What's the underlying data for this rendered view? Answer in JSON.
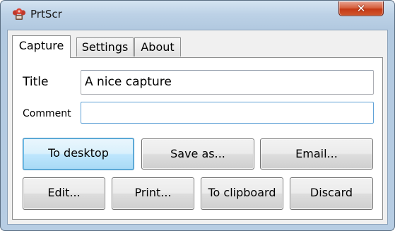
{
  "window": {
    "title": "PrtScr",
    "close_glyph": "✕"
  },
  "tabs": [
    {
      "label": "Capture",
      "active": true
    },
    {
      "label": "Settings",
      "active": false
    },
    {
      "label": "About",
      "active": false
    }
  ],
  "form": {
    "title_label": "Title",
    "title_value": "A nice capture",
    "comment_label": "Comment",
    "comment_value": ""
  },
  "buttons": {
    "to_desktop": "To desktop",
    "save_as": "Save as...",
    "email": "Email...",
    "edit": "Edit...",
    "print": "Print...",
    "to_clipboard": "To clipboard",
    "discard": "Discard"
  },
  "icons": {
    "app": "prtscr-app-icon",
    "close": "close-icon"
  },
  "colors": {
    "default_button_border": "#3c7fb1",
    "close_button": "#c53a16",
    "focused_field_border": "#5fa1d6"
  }
}
